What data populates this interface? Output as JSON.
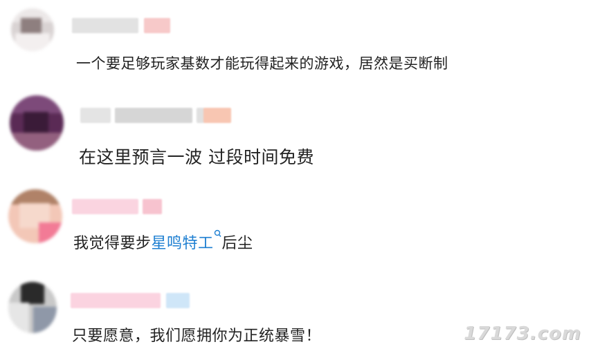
{
  "comments": [
    {
      "text": "一个要足够玩家基数才能玩得起来的游戏，居然是买断制"
    },
    {
      "text": "在这里预言一波 过段时间免费"
    },
    {
      "text_before": "我觉得要步",
      "topic": "星鸣特工",
      "topic_icon": "search-icon",
      "text_after": "后尘"
    },
    {
      "text": "只要愿意，我们愿拥你为正统暴雪！"
    }
  ],
  "watermark": "17173.com",
  "colors": {
    "topic_link": "#1e7fd1",
    "text": "#222222"
  }
}
